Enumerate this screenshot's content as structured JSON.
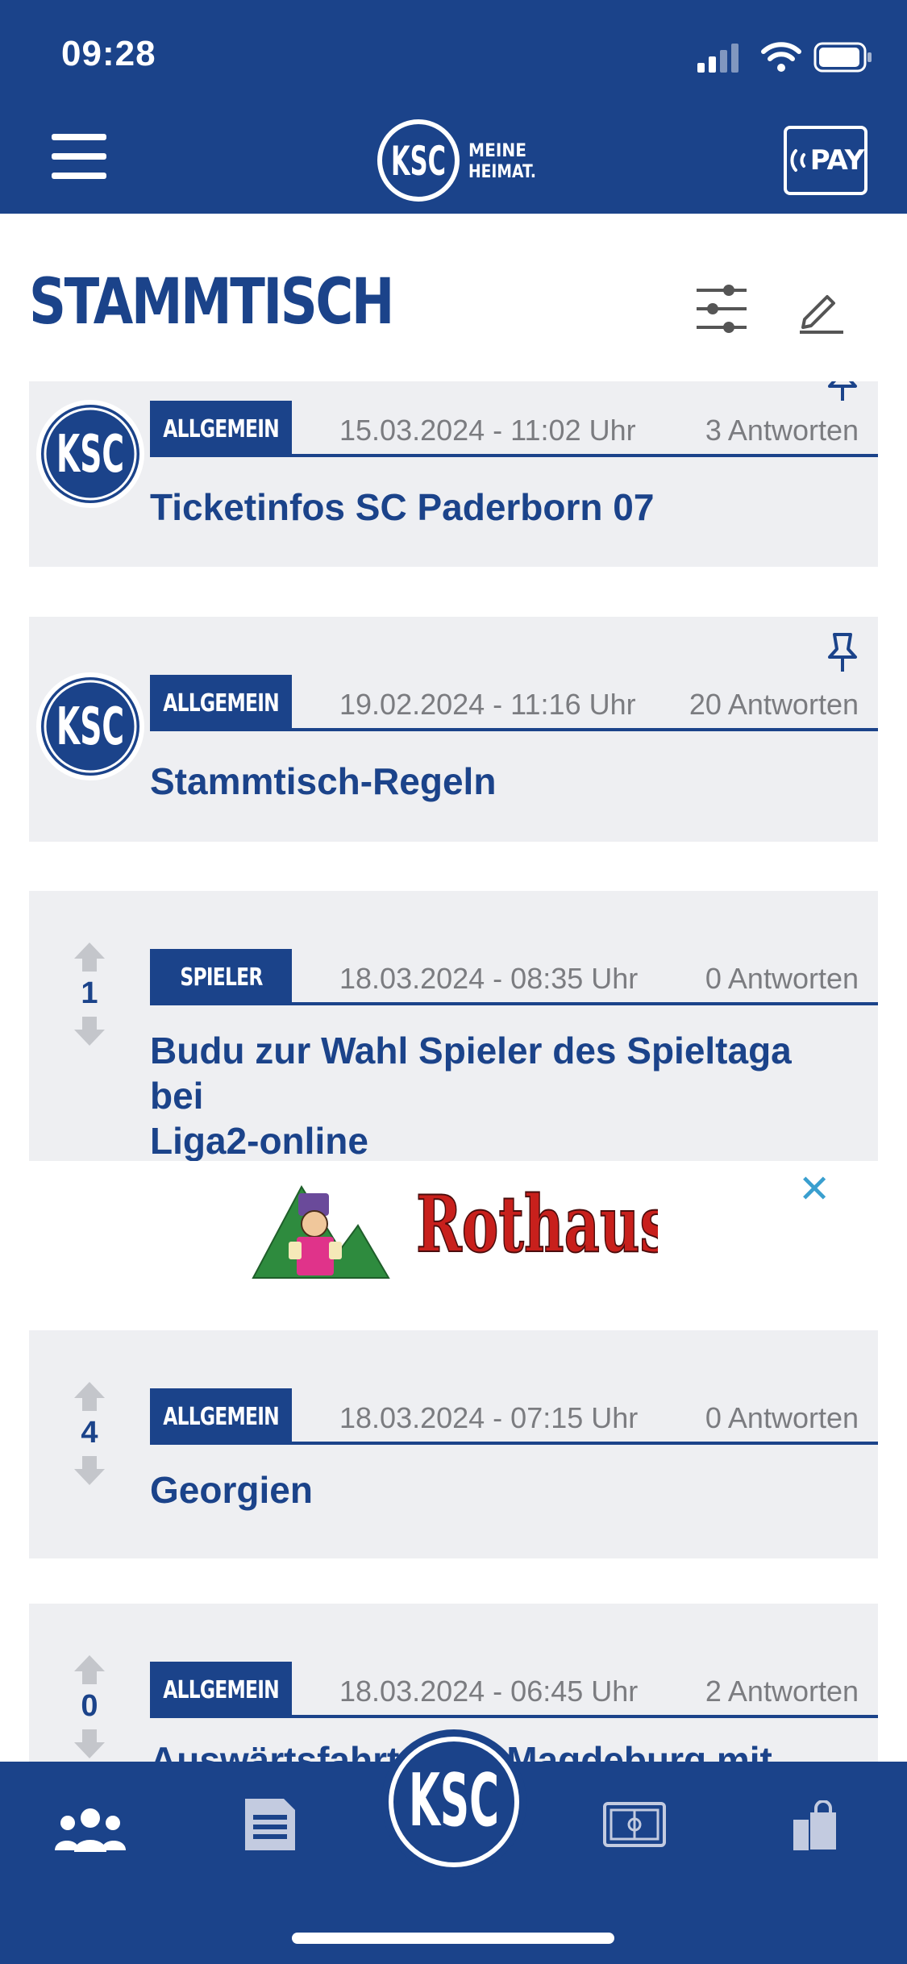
{
  "status_bar": {
    "time": "09:28"
  },
  "header": {
    "brand_text_line1": "MEINE",
    "brand_text_line2": "HEIMAT.",
    "brand_logo_text": "KSC",
    "pay_label": "PAY",
    "icons": {
      "menu": "hamburger-menu-icon",
      "pay": "contactless-pay-icon"
    }
  },
  "page": {
    "title": "STAMMTISCH",
    "icons": {
      "filter": "sliders-filter-icon",
      "edit": "pencil-edit-icon"
    }
  },
  "posts": [
    {
      "avatar_text": "KSC",
      "category": "ALLGEMEIN",
      "date": "15.03.2024 - 11:02 Uhr",
      "replies": "3 Antworten",
      "title": "Ticketinfos SC Paderborn 07",
      "pinned": true
    },
    {
      "avatar_text": "KSC",
      "category": "ALLGEMEIN",
      "date": "19.02.2024 - 11:16 Uhr",
      "replies": "20 Antworten",
      "title": "Stammtisch-Regeln",
      "pinned": true
    },
    {
      "votes": "1",
      "category": "SPIELER",
      "date": "18.03.2024 - 08:35 Uhr",
      "replies": "0 Antworten",
      "title_line1": "Budu zur Wahl Spieler des Spieltaga bei",
      "title_line2": "Liga2-online"
    },
    {
      "votes": "4",
      "category": "ALLGEMEIN",
      "date": "18.03.2024 - 07:15 Uhr",
      "replies": "0 Antworten",
      "title": "Georgien"
    },
    {
      "votes": "0",
      "category": "ALLGEMEIN",
      "date": "18.03.2024 - 06:45 Uhr",
      "replies": "2 Antworten",
      "title": "Auswärtsfahrt nach Magdeburg mit dem KSC"
    }
  ],
  "ad": {
    "brand": "Rothaus",
    "close": "✕"
  },
  "bottom_nav": {
    "center_logo_text": "KSC",
    "items": [
      "community-icon",
      "news-icon",
      "ksc-home-logo",
      "stadium-icon",
      "shop-icon"
    ]
  },
  "colors": {
    "primary": "#1b438a",
    "card_bg": "#eeeff2",
    "meta_text": "#7b7c80",
    "close_accent": "#3a9fcf"
  }
}
